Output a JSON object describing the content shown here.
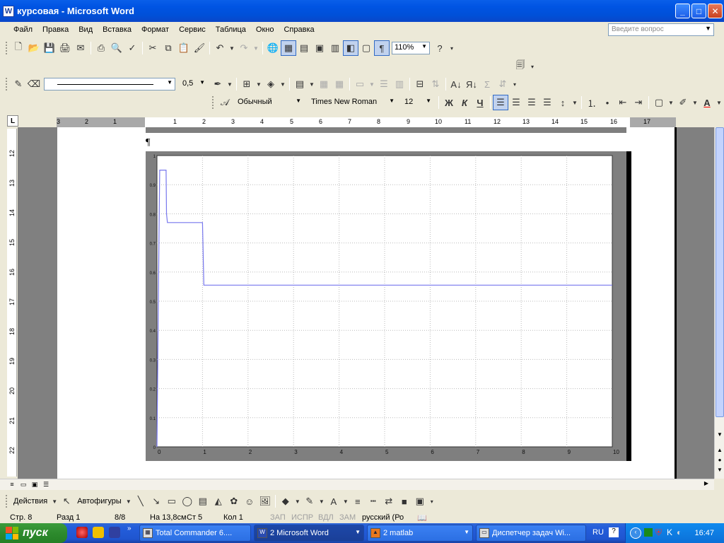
{
  "window": {
    "title": "курсовая - Microsoft Word",
    "app_icon": "W",
    "buttons": [
      "minimize-icon",
      "maximize-icon",
      "close-icon"
    ]
  },
  "menu": [
    "Файл",
    "Правка",
    "Вид",
    "Вставка",
    "Формат",
    "Сервис",
    "Таблица",
    "Окно",
    "Справка"
  ],
  "help_box": {
    "placeholder": "Введите вопрос"
  },
  "standard_toolbar": {
    "zoom": "110%"
  },
  "drawing_props_toolbar": {
    "line_width": "0,5"
  },
  "format_toolbar": {
    "style": "Обычный",
    "font": "Times New Roman",
    "size": "12",
    "bold": "Ж",
    "italic": "К",
    "underline": "Ч"
  },
  "ruler": {
    "corner": "L",
    "left_numbers": [
      "3",
      "2",
      "1"
    ],
    "numbers": [
      "1",
      "2",
      "3",
      "4",
      "5",
      "6",
      "7",
      "8",
      "9",
      "10",
      "11",
      "12",
      "13",
      "14",
      "15",
      "16",
      "17"
    ],
    "vertical_numbers": [
      "12",
      "13",
      "14",
      "15",
      "16",
      "17",
      "18",
      "19",
      "20",
      "21",
      "22"
    ]
  },
  "document": {
    "paragraph_mark": "¶"
  },
  "chart_data": {
    "type": "line",
    "x": [
      0,
      0.05,
      0.06,
      0.1,
      0.2,
      0.21,
      0.23,
      0.26,
      1.0,
      1.03,
      10
    ],
    "series": [
      {
        "values": [
          0,
          0.8,
          0.95,
          0.95,
          0.95,
          0.8,
          0.77,
          0.77,
          0.77,
          0.555,
          0.555
        ],
        "color": "#7777EE"
      }
    ],
    "xlim": [
      0,
      10
    ],
    "ylim": [
      0,
      1
    ],
    "xticks": [
      "0",
      "1",
      "2",
      "3",
      "4",
      "5",
      "6",
      "7",
      "8",
      "9",
      "10"
    ],
    "yticks": [
      "0",
      "0.1",
      "0.2",
      "0.3",
      "0.4",
      "0.5",
      "0.6",
      "0.7",
      "0.8",
      "0.9",
      "1"
    ],
    "grid": true
  },
  "drawing_toolbar": {
    "actions": "Действия",
    "autoshapes": "Автофигуры"
  },
  "status": {
    "page": "Стр. 8",
    "section": "Разд 1",
    "pages": "8/8",
    "at": "На 13,8см",
    "line": "Ст 5",
    "col": "Кол 1",
    "rec": "ЗАП",
    "trk": "ИСПР",
    "ext": "ВДЛ",
    "ovr": "ЗАМ",
    "lang": "русский (Ро"
  },
  "taskbar": {
    "start": "пуск",
    "tasks": [
      {
        "label": "Total Commander 6....",
        "icon": "total-commander-icon"
      },
      {
        "label": "2 Microsoft Word",
        "icon": "word-icon"
      },
      {
        "label": "2 matlab",
        "icon": "matlab-icon"
      },
      {
        "label": "Диспетчер задач Wi...",
        "icon": "task-manager-icon"
      }
    ],
    "lang": "RU",
    "clock": "16:47"
  }
}
